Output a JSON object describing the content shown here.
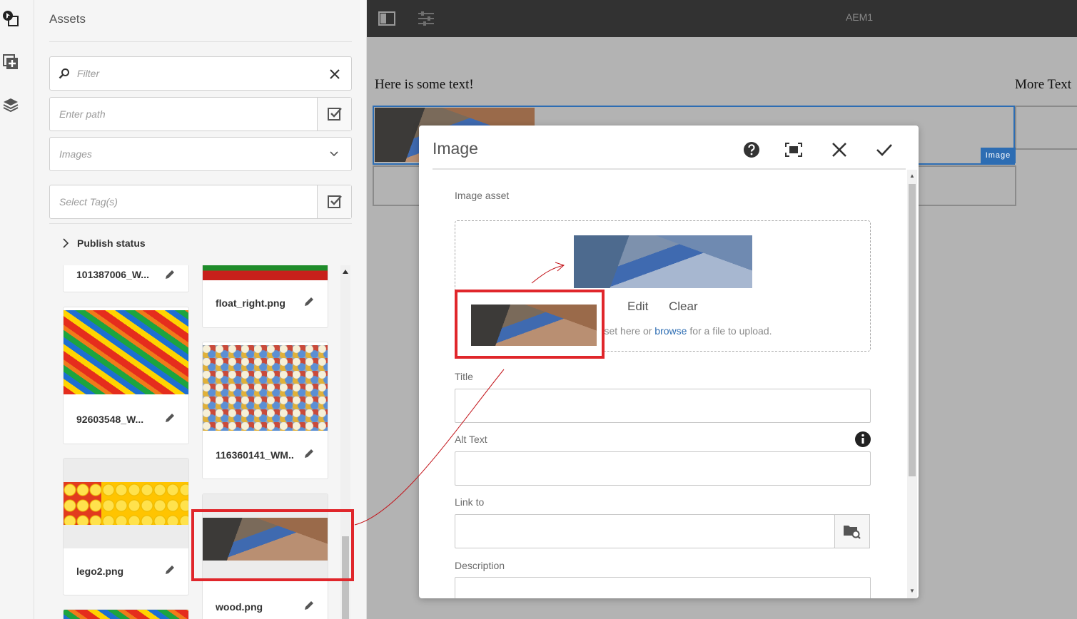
{
  "rail": {
    "items": [
      {
        "name": "assets-finder-icon"
      },
      {
        "name": "components-icon"
      },
      {
        "name": "content-tree-icon"
      }
    ]
  },
  "panel": {
    "title": "Assets",
    "filter_placeholder": "Filter",
    "path_placeholder": "Enter path",
    "type_value": "Images",
    "tags_placeholder": "Select Tag(s)",
    "publish_status": "Publish status"
  },
  "assets": {
    "left": [
      {
        "name": "101387006_W..."
      },
      {
        "name": "92603548_W..."
      },
      {
        "name": "lego2.png"
      }
    ],
    "right": [
      {
        "name": "float_right.png"
      },
      {
        "name": "116360141_WM.."
      },
      {
        "name": "wood.png"
      }
    ]
  },
  "editor": {
    "page_name": "AEM1",
    "text_left": "Here is some text!",
    "text_right": "More Text",
    "component_badge": "Image"
  },
  "dialog": {
    "title": "Image",
    "image_asset_label": "Image asset",
    "edit_label": "Edit",
    "clear_label": "Clear",
    "hint_prefix": "Drop an asset here or ",
    "hint_link": "browse",
    "hint_suffix": " for a file to upload.",
    "title_label": "Title",
    "alt_label": "Alt Text",
    "link_label": "Link to",
    "description_label": "Description"
  },
  "colors": {
    "accent": "#2d6db3",
    "annotation": "#e0262b",
    "topbar": "#323232"
  }
}
